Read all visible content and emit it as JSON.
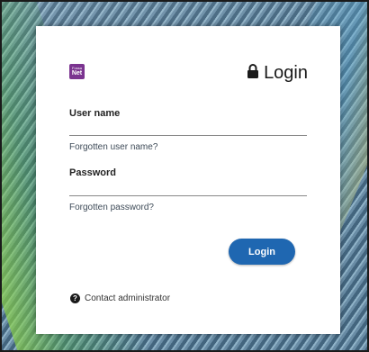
{
  "brand": {
    "logo_line1": "Fossa",
    "logo_line2": "Net",
    "logo_color": "#7b3490"
  },
  "header": {
    "title": "Login",
    "icon": "lock-icon"
  },
  "form": {
    "username": {
      "label": "User name",
      "value": "",
      "forgot_link": "Forgotten user name?"
    },
    "password": {
      "label": "Password",
      "value": "",
      "forgot_link": "Forgotten password?"
    },
    "submit_label": "Login",
    "submit_color": "#1f67b1"
  },
  "footer": {
    "contact_label": "Contact administrator",
    "icon": "help-icon"
  }
}
